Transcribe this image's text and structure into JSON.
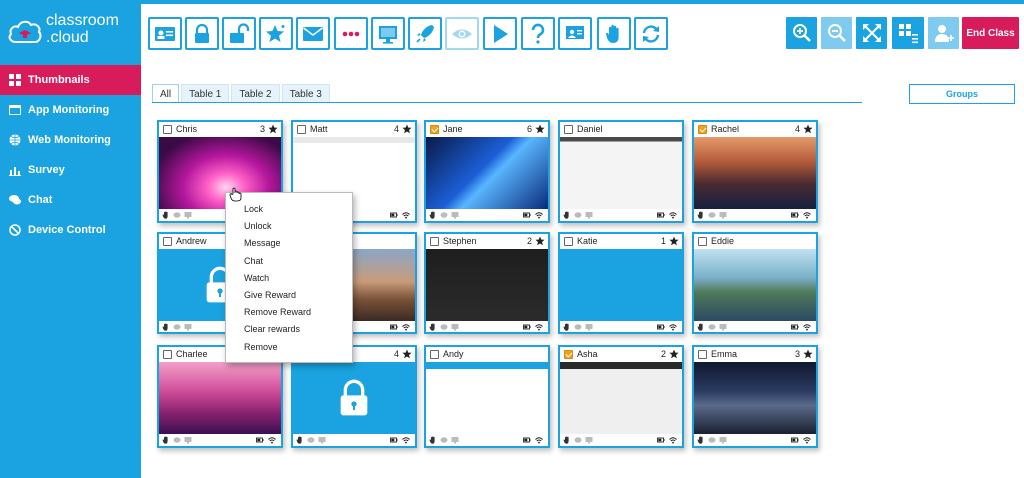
{
  "app": {
    "brand": {
      "line1": "classroom",
      "line2": ".cloud"
    },
    "colors": {
      "primary": "#1aa3e0",
      "accent": "#d81b5b",
      "check": "#f0a21c"
    }
  },
  "sidebar": {
    "items": [
      {
        "label": "Thumbnails",
        "icon": "thumbnails-icon",
        "active": true
      },
      {
        "label": "App Monitoring",
        "icon": "window-icon"
      },
      {
        "label": "Web Monitoring",
        "icon": "globe-icon"
      },
      {
        "label": "Survey",
        "icon": "bar-chart-icon"
      },
      {
        "label": "Chat",
        "icon": "chat-icon"
      },
      {
        "label": "Device Control",
        "icon": "no-entry-icon"
      }
    ]
  },
  "toolbar": {
    "buttons": [
      "register-icon",
      "lock-icon",
      "unlock-icon",
      "reward-star-icon",
      "message-icon",
      "dots-icon",
      "screen-icon",
      "rocket-icon",
      "eye-icon",
      "play-icon",
      "help-icon",
      "present-icon",
      "hand-icon",
      "refresh-icon"
    ],
    "right_buttons": [
      "zoom-in-icon",
      "zoom-out-icon",
      "fit-icon",
      "groups-list-icon",
      "add-user-icon"
    ],
    "end_class_label": "End Class"
  },
  "tabs": [
    "All",
    "Table 1",
    "Table 2",
    "Table 3"
  ],
  "groups_label": "Groups",
  "students": [
    {
      "name": "Chris",
      "count": "3",
      "checked": false,
      "theme": "pink-burst"
    },
    {
      "name": "Matt",
      "count": "4",
      "checked": false,
      "theme": "google-white"
    },
    {
      "name": "Jane",
      "count": "6",
      "checked": true,
      "theme": "windows-blue"
    },
    {
      "name": "Daniel",
      "count": "",
      "checked": false,
      "theme": "app-window"
    },
    {
      "name": "Rachel",
      "count": "4",
      "checked": true,
      "theme": "sierra"
    },
    {
      "name": "Andrew",
      "count": "",
      "checked": false,
      "theme": "lock-blue"
    },
    {
      "name": "",
      "count": "",
      "checked": false,
      "theme": "mojave-dune"
    },
    {
      "name": "Stephen",
      "count": "2",
      "checked": false,
      "theme": "google-dark"
    },
    {
      "name": "Katie",
      "count": "1",
      "checked": false,
      "theme": "cloud-login"
    },
    {
      "name": "Eddie",
      "count": "",
      "checked": false,
      "theme": "catalina"
    },
    {
      "name": "Charlee",
      "count": "",
      "checked": false,
      "theme": "pink-hills"
    },
    {
      "name": "",
      "count": "4",
      "checked": false,
      "theme": "lock-blue2"
    },
    {
      "name": "Andy",
      "count": "",
      "checked": false,
      "theme": "web-app"
    },
    {
      "name": "Asha",
      "count": "2",
      "checked": true,
      "theme": "photo-desktop"
    },
    {
      "name": "Emma",
      "count": "3",
      "checked": false,
      "theme": "mojave-night"
    }
  ],
  "context_menu": {
    "items": [
      "Lock",
      "Unlock",
      "Message",
      "Chat",
      "Watch",
      "Give Reward",
      "Remove Reward",
      "Clear rewards",
      "Remove"
    ]
  }
}
